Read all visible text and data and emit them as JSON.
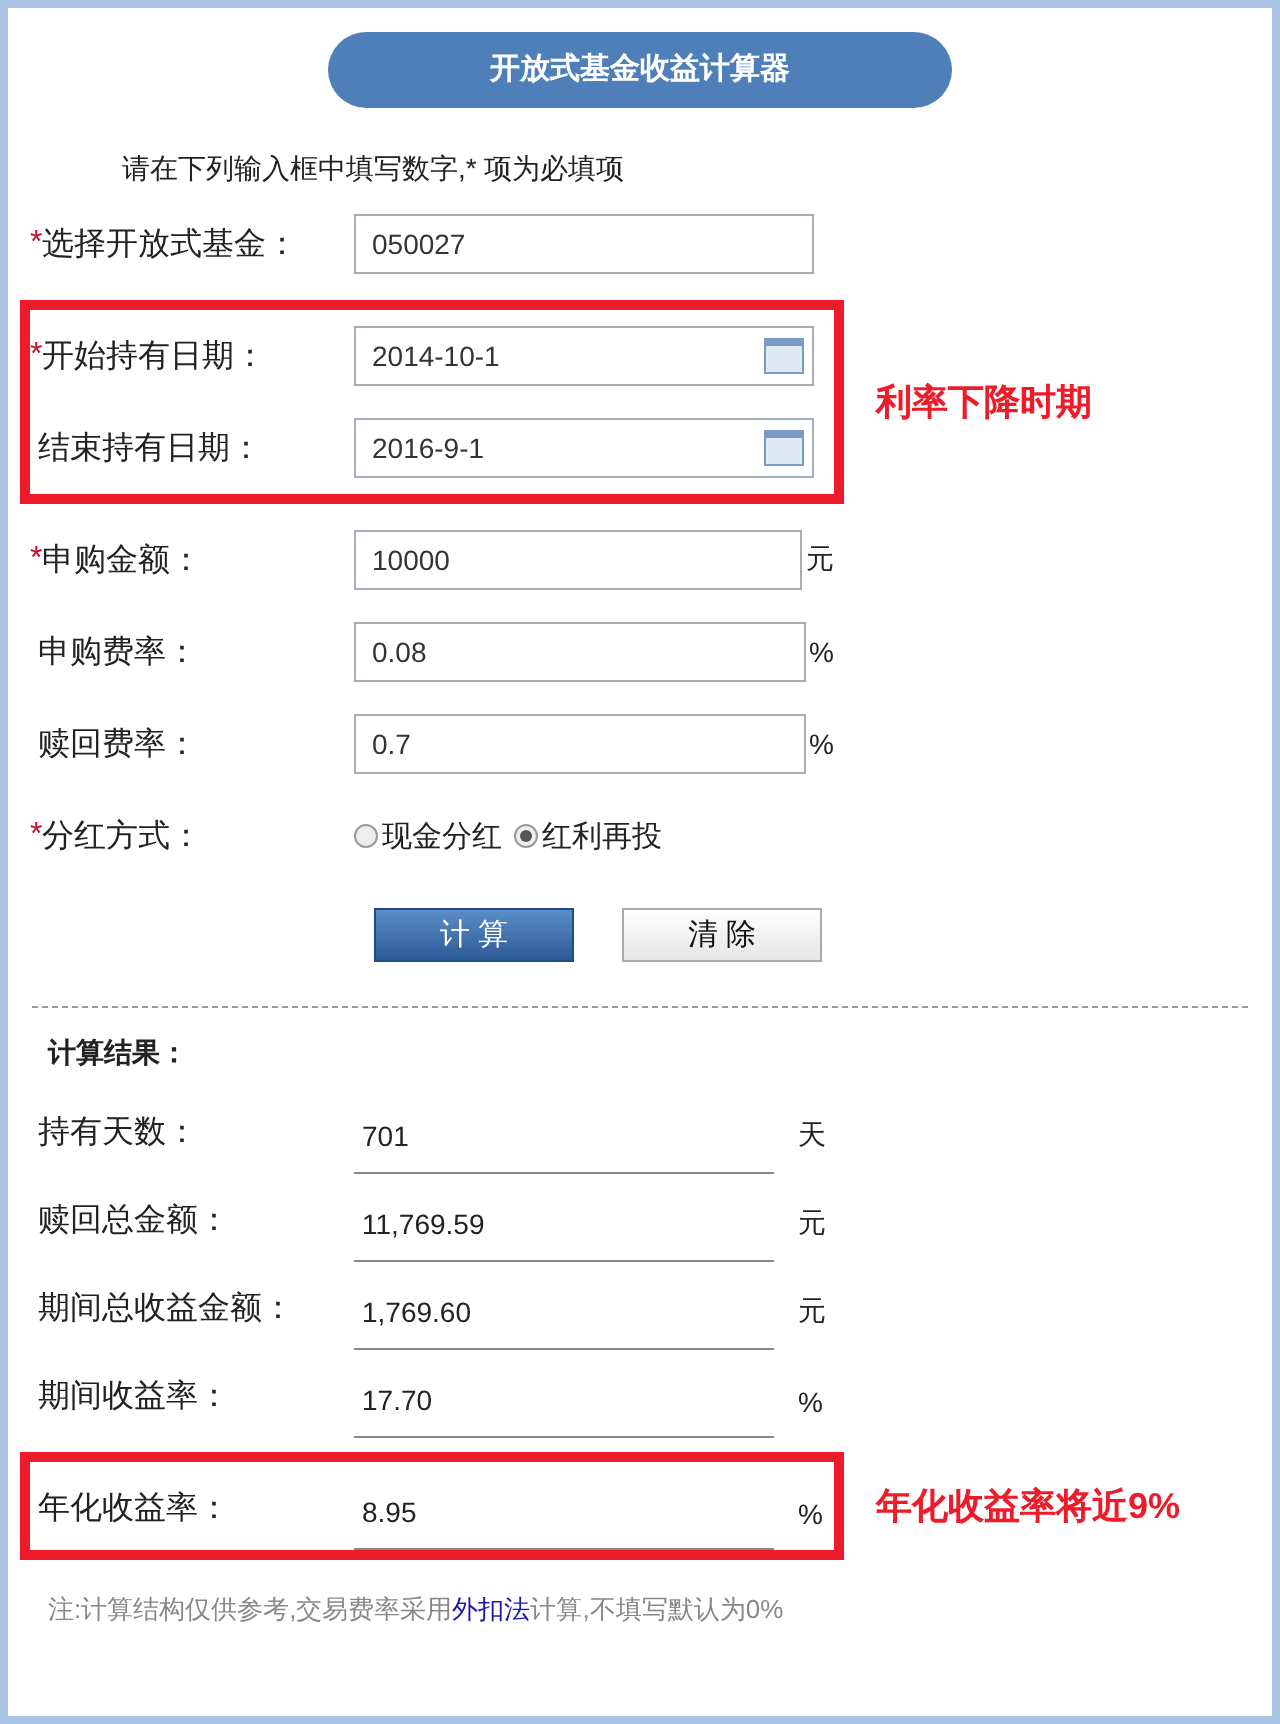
{
  "title": "开放式基金收益计算器",
  "instruction": "请在下列输入框中填写数字,* 项为必填项",
  "form_groups": [
    {
      "fields": [
        {
          "kind": "text",
          "required_mark": "*",
          "label": "选择开放式基金：",
          "value": "050027"
        }
      ]
    },
    {
      "callout": "利率下降时期",
      "fields": [
        {
          "kind": "date",
          "required_mark": "*",
          "label": "开始持有日期：",
          "value": "2014-10-1"
        },
        {
          "kind": "date",
          "label": "结束持有日期：",
          "value": "2016-9-1"
        }
      ]
    },
    {
      "fields": [
        {
          "kind": "text",
          "required_mark": "*",
          "label": "申购金额：",
          "value": "10000",
          "unit": "元"
        },
        {
          "kind": "text",
          "label": "申购费率：",
          "value": "0.08",
          "unit": "%"
        },
        {
          "kind": "text",
          "label": "赎回费率：",
          "value": "0.7",
          "unit": "%"
        },
        {
          "kind": "radio",
          "required_mark": "*",
          "label": "分红方式：",
          "options": [
            {
              "label": "现金分红",
              "selected": false
            },
            {
              "label": "红利再投",
              "selected": true
            }
          ]
        }
      ]
    }
  ],
  "buttons": [
    {
      "label": "计 算",
      "kind": "primary"
    },
    {
      "label": "清 除",
      "kind": "secondary"
    }
  ],
  "results_heading": "计算结果：",
  "result_groups": [
    {
      "rows": [
        {
          "label": "持有天数：",
          "value": "701",
          "unit": "天"
        },
        {
          "label": "赎回总金额：",
          "value": "11,769.59",
          "unit": "元"
        },
        {
          "label": "期间总收益金额：",
          "value": "1,769.60",
          "unit": "元"
        },
        {
          "label": "期间收益率：",
          "value": "17.70",
          "unit": "%"
        }
      ]
    },
    {
      "callout": "年化收益率将近9%",
      "rows": [
        {
          "label": "年化收益率：",
          "value": "8.95",
          "unit": "%"
        }
      ]
    }
  ],
  "note": {
    "before": "注:计算结构仅供参考,交易费率采用",
    "link": "外扣法",
    "after": "计算,不填写默认为0%"
  }
}
